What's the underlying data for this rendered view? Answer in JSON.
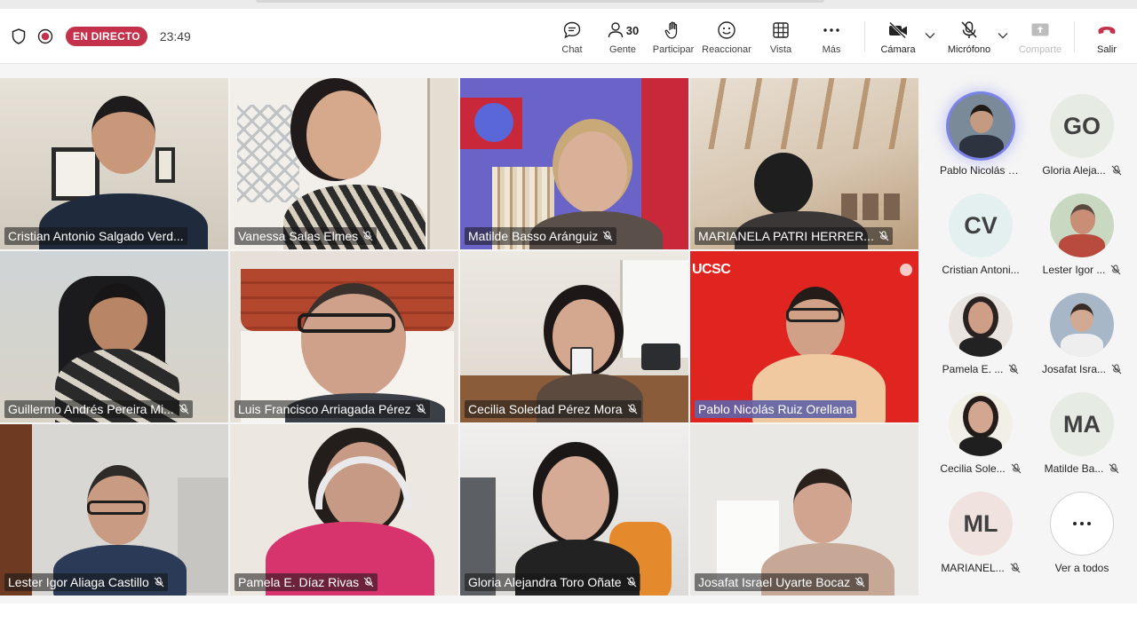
{
  "toolbar": {
    "live_label": "EN DIRECTO",
    "timer": "23:49",
    "people_count": "30",
    "buttons": {
      "chat": "Chat",
      "people": "Gente",
      "raise": "Participar",
      "react": "Reaccionar",
      "view": "Vista",
      "more": "Más",
      "camera": "Cámara",
      "mic": "Micrófono",
      "share": "Comparte",
      "leave": "Salir"
    }
  },
  "grid": {
    "tiles": [
      {
        "name": "Cristian Antonio Salgado Verd..."
      },
      {
        "name": "Vanessa Salas Elmes"
      },
      {
        "name": "Matilde Basso Aránguiz"
      },
      {
        "name": "MARIANELA PATRI HERRER..."
      },
      {
        "name": "Guillermo Andrés Pereira Mi..."
      },
      {
        "name": "Luis Francisco Arriagada Pérez"
      },
      {
        "name": "Cecilia Soledad Pérez Mora"
      },
      {
        "name": "Pablo Nicolás Ruiz Orellana"
      },
      {
        "name": "Lester Igor Aliaga Castillo"
      },
      {
        "name": "Pamela E. Díaz Rivas"
      },
      {
        "name": "Gloria Alejandra Toro Oñate"
      },
      {
        "name": "Josafat Israel Uyarte Bocaz"
      }
    ],
    "slide_brand": "UCSC"
  },
  "roster": {
    "items": [
      {
        "name": "Pablo Nicolás R...",
        "initials": ""
      },
      {
        "name": "Gloria Aleja...",
        "initials": "GO"
      },
      {
        "name": "Cristian Antoni...",
        "initials": "CV"
      },
      {
        "name": "Lester Igor ...",
        "initials": ""
      },
      {
        "name": "Pamela E. ...",
        "initials": ""
      },
      {
        "name": "Josafat Isra...",
        "initials": ""
      },
      {
        "name": "Cecilia Sole...",
        "initials": ""
      },
      {
        "name": "Matilde Ba...",
        "initials": "MA"
      },
      {
        "name": "MARIANEL...",
        "initials": "ML"
      }
    ],
    "see_all": "Ver a todos"
  },
  "colors": {
    "live": "#c4314b",
    "leave": "#c4314b",
    "speaker_ring": "#7b83eb",
    "highlight_label": "#6264a7"
  }
}
